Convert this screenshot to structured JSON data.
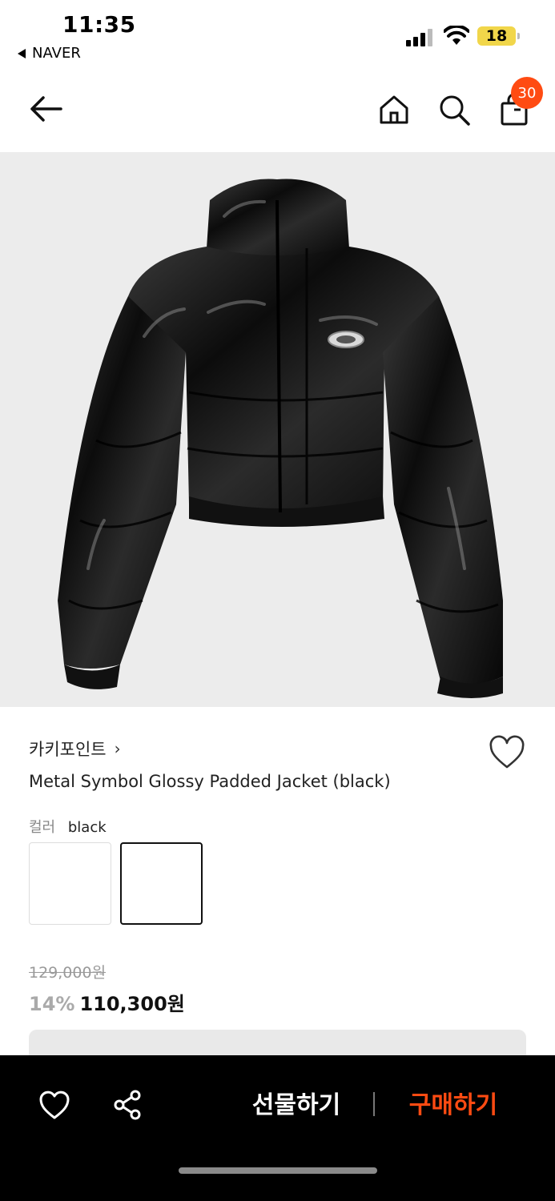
{
  "status_bar": {
    "time": "11:35",
    "back_app": "NAVER",
    "battery": "18"
  },
  "header": {
    "back_icon": "arrow-left-icon",
    "home_icon": "home-icon",
    "search_icon": "search-icon",
    "cart_icon": "shopping-bag-icon",
    "cart_count": "30",
    "badge_color": "#ff4b12"
  },
  "product": {
    "image_alt": "black glossy cropped padded jacket",
    "brand": "카키포인트",
    "brand_chevron": "›",
    "name": "Metal Symbol Glossy Padded Jacket (black)",
    "option_label": "컬러",
    "option_value": "black",
    "original_price": "129,000원",
    "discount": "14%",
    "sale_price": "110,300원"
  },
  "bottom_bar": {
    "gift_label": "선물하기",
    "buy_label": "구매하기",
    "buy_color": "#ff4b12"
  }
}
